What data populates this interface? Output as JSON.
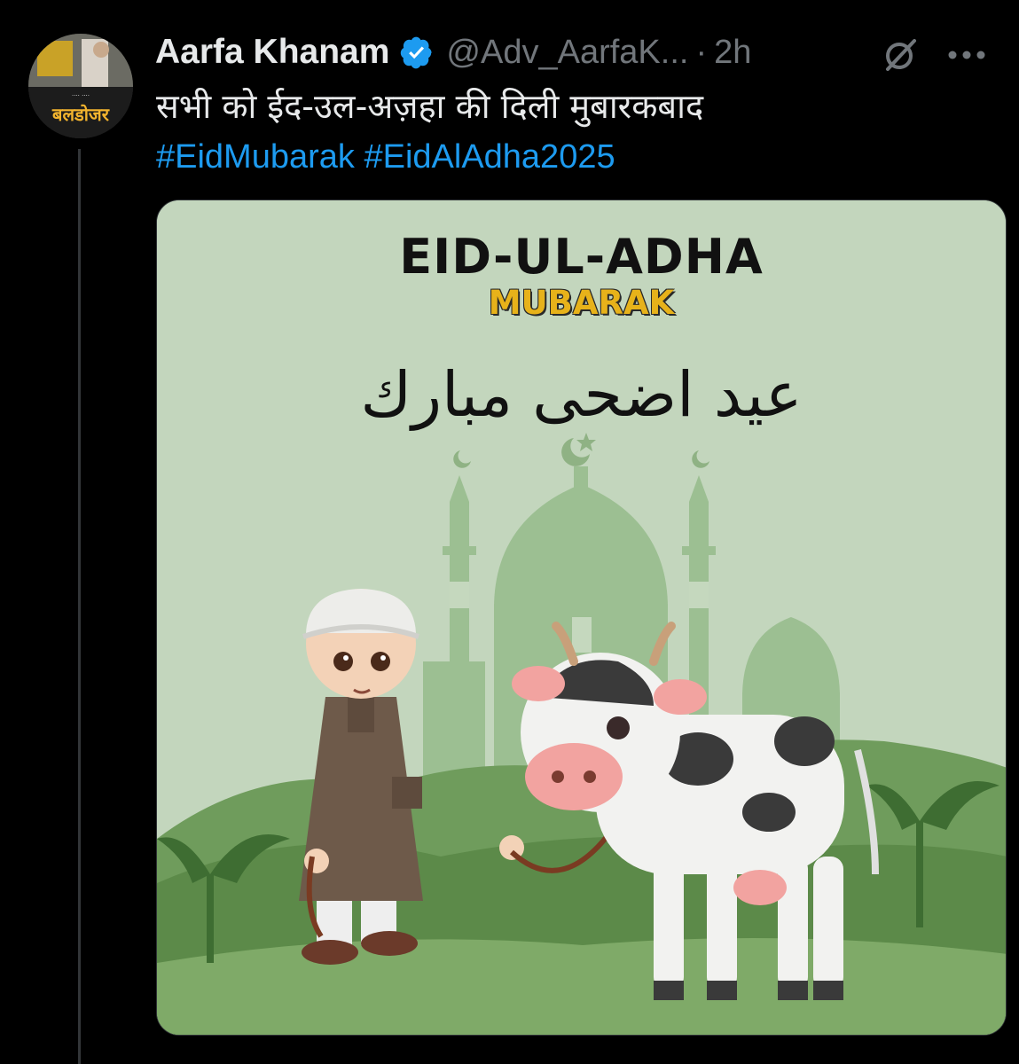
{
  "tweet": {
    "author_name": "Aarfa Khanam",
    "handle": "@Adv_AarfaK...",
    "separator": "·",
    "time": "2h",
    "text": "सभी को ईद-उल-अज़हा की दिली मुबारकबाद",
    "hashtags": [
      "#EidMubarak",
      "#EidAlAdha2025"
    ]
  },
  "avatar": {
    "caption": "बलडोजर"
  },
  "media": {
    "title": "EID-UL-ADHA",
    "subtitle": "MUBARAK",
    "arabic": "عيد اضحى مبارك"
  },
  "icons": {
    "verified": "verified-badge-icon",
    "grok": "grok-icon",
    "more": "more-icon"
  },
  "colors": {
    "background": "#000000",
    "text_primary": "#e7e9ea",
    "text_secondary": "#71767b",
    "link": "#1d9bf0",
    "image_background": "#bfd3b9"
  }
}
